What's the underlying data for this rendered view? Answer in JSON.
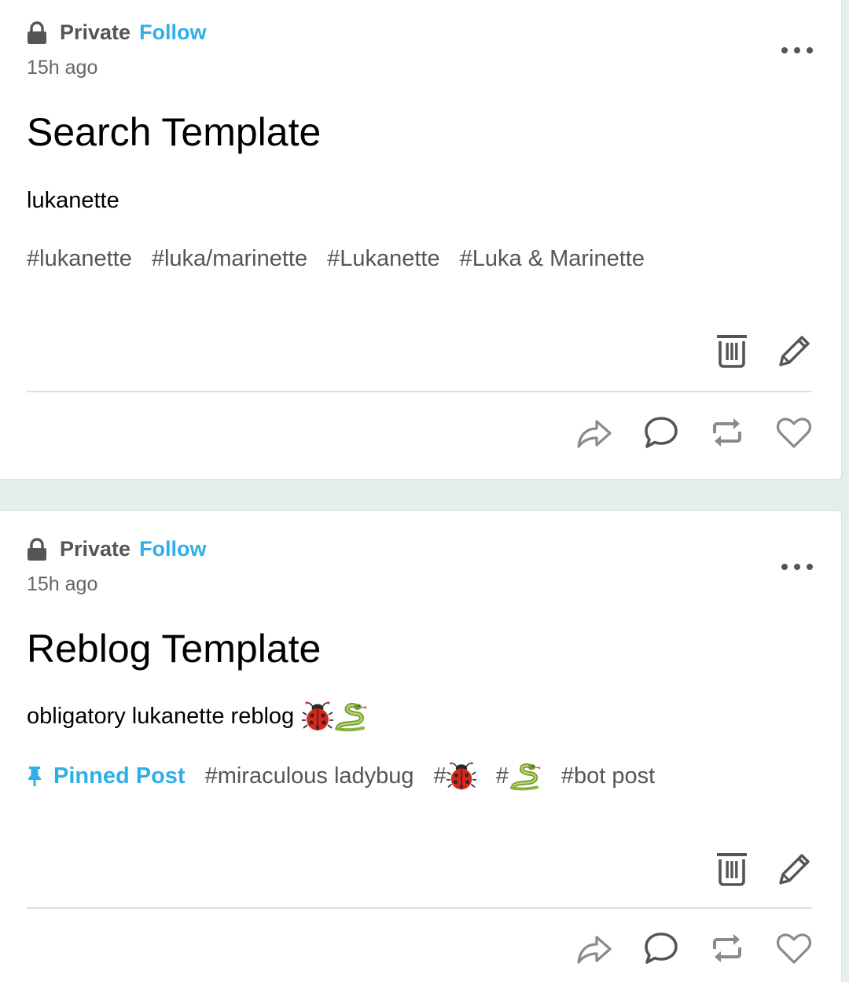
{
  "colors": {
    "accent": "#2eafe8",
    "page_background": "#e3efe9",
    "card_background": "#ffffff",
    "meta_text": "#555555"
  },
  "posts": [
    {
      "visibility": "Private",
      "follow_label": "Follow",
      "timestamp": "15h ago",
      "title": "Search Template",
      "body": "lukanette",
      "pinned_label": null,
      "tags": [
        "#lukanette",
        "#luka/marinette",
        "#Lukanette",
        "#Luka & Marinette"
      ],
      "icons": [
        "lock-icon",
        "more-options-icon",
        "trash-icon",
        "pencil-icon",
        "share-icon",
        "comment-icon",
        "reblog-icon",
        "heart-icon"
      ]
    },
    {
      "visibility": "Private",
      "follow_label": "Follow",
      "timestamp": "15h ago",
      "title": "Reblog Template",
      "body": "obligatory lukanette reblog",
      "body_emojis": [
        "ladybug",
        "snake"
      ],
      "pinned_label": "Pinned Post",
      "tags": [
        "#miraculous ladybug",
        "#",
        "#",
        "#bot post"
      ],
      "tag_emojis": [
        null,
        "ladybug",
        "snake",
        null
      ],
      "icons": [
        "lock-icon",
        "more-options-icon",
        "pin-icon",
        "trash-icon",
        "pencil-icon",
        "share-icon",
        "comment-icon",
        "reblog-icon",
        "heart-icon"
      ]
    }
  ]
}
